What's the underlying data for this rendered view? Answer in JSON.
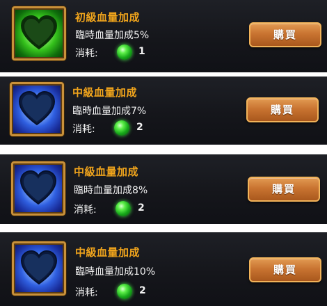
{
  "items": [
    {
      "title": "初級血量加成",
      "desc": "臨時血量加成5%",
      "cost_label": "消耗:",
      "cost": "1",
      "icon": "heart-icon",
      "frame_color": "green",
      "buy_label": "購買"
    },
    {
      "title": "中級血量加成",
      "desc": "臨時血量加成7%",
      "cost_label": "消耗:",
      "cost": "2",
      "icon": "heart-icon",
      "frame_color": "blue",
      "buy_label": "購買"
    },
    {
      "title": "中級血量加成",
      "desc": "臨時血量加成8%",
      "cost_label": "消耗:",
      "cost": "2",
      "icon": "heart-icon",
      "frame_color": "blue",
      "buy_label": "購買"
    },
    {
      "title": "中級血量加成",
      "desc": "臨時血量加成10%",
      "cost_label": "消耗:",
      "cost": "2",
      "icon": "heart-icon",
      "frame_color": "blue",
      "buy_label": "購買"
    }
  ],
  "colors": {
    "title": "#f0a41c",
    "text": "#f2f2f2",
    "button": "#c97431",
    "panel": "#17181d"
  }
}
